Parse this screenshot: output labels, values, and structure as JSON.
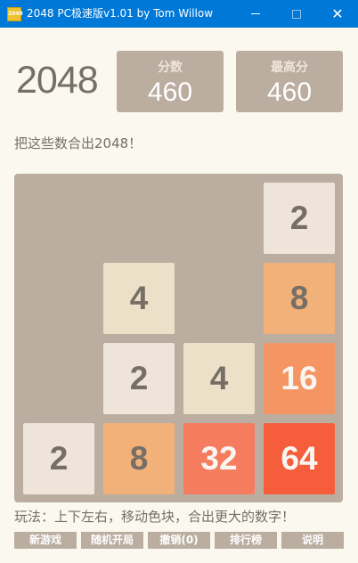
{
  "window": {
    "title": "2048 PC极速版v1.01 by Tom Willow",
    "icon_label": "2048",
    "buttons": [
      "minimize-icon",
      "maximize-icon",
      "close-icon"
    ],
    "close_glyph": "✕",
    "accent_color": "#0078d7"
  },
  "header": {
    "logo": "2048",
    "score_label": "分数",
    "score_value": "460",
    "best_label": "最高分",
    "best_value": "460"
  },
  "intro_text": "把这些数合出2048！",
  "board": {
    "size": 4,
    "rows": [
      [
        null,
        null,
        null,
        2
      ],
      [
        null,
        4,
        null,
        8
      ],
      [
        null,
        2,
        4,
        16
      ],
      [
        2,
        8,
        32,
        64
      ]
    ],
    "tile_colors": {
      "2": "#eee4da",
      "4": "#ede0c8",
      "8": "#f2b179",
      "16": "#f59563",
      "32": "#f67c5f",
      "64": "#f65e3b"
    }
  },
  "tiles": {
    "r0c3": "2",
    "r1c1": "4",
    "r1c3": "8",
    "r2c1": "2",
    "r2c2": "4",
    "r2c3": "16",
    "r3c0": "2",
    "r3c1": "8",
    "r3c2": "32",
    "r3c3": "64"
  },
  "instructions": "玩法：上下左右，移动色块，合出更大的数字！",
  "actions": {
    "new_game": "新游戏",
    "random_start": "随机开局",
    "undo": "撤销(0)",
    "leaderboard": "排行榜",
    "help": "说明"
  }
}
